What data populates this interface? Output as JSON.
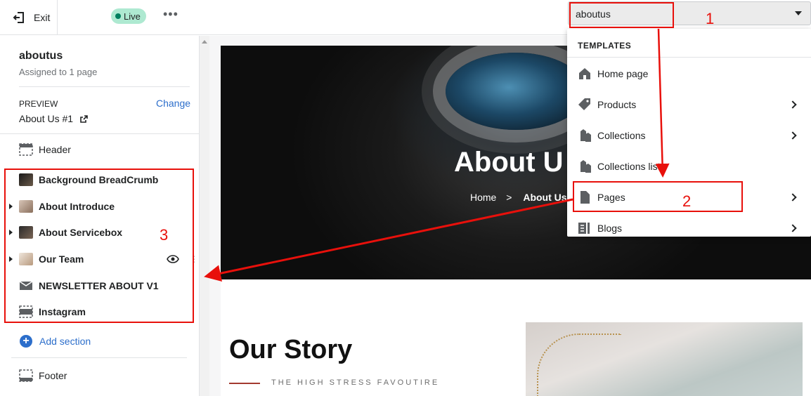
{
  "topbar": {
    "exit_label": "Exit",
    "status_badge": "Live",
    "more_label": "•••",
    "template_select_value": "aboutus"
  },
  "sidebar": {
    "template_name": "aboutus",
    "assigned": "Assigned to 1 page",
    "preview_label": "PREVIEW",
    "preview_value": "About Us #1",
    "change_label": "Change",
    "header_label": "Header",
    "sections": [
      {
        "label": "Background BreadCrumb"
      },
      {
        "label": "About Introduce"
      },
      {
        "label": "About Servicebox"
      },
      {
        "label": "Our Team"
      },
      {
        "label": "NEWSLETTER ABOUT V1"
      },
      {
        "label": "Instagram"
      }
    ],
    "add_section_label": "Add section",
    "footer_label": "Footer"
  },
  "preview": {
    "hero_title": "About U",
    "crumb_home": "Home",
    "crumb_sep": ">",
    "crumb_current": "About Us",
    "story_title": "Our Story",
    "story_subtitle": "THE HIGH STRESS FAVOUTIRE"
  },
  "dropdown": {
    "heading": "TEMPLATES",
    "items": [
      {
        "label": "Home page",
        "icon": "home-icon",
        "has_submenu": false
      },
      {
        "label": "Products",
        "icon": "tag-icon",
        "has_submenu": true
      },
      {
        "label": "Collections",
        "icon": "collection-icon",
        "has_submenu": true
      },
      {
        "label": "Collections list",
        "icon": "collection-icon",
        "has_submenu": false
      },
      {
        "label": "Pages",
        "icon": "page-icon",
        "has_submenu": true
      },
      {
        "label": "Blogs",
        "icon": "blog-icon",
        "has_submenu": true
      }
    ]
  },
  "annotations": {
    "num1": "1",
    "num2": "2",
    "num3": "3",
    "color": "#e8100b"
  },
  "colors": {
    "accent_blue": "#2c6ecb",
    "live_badge_bg": "#aee9d1",
    "live_dot": "#007f5f"
  }
}
